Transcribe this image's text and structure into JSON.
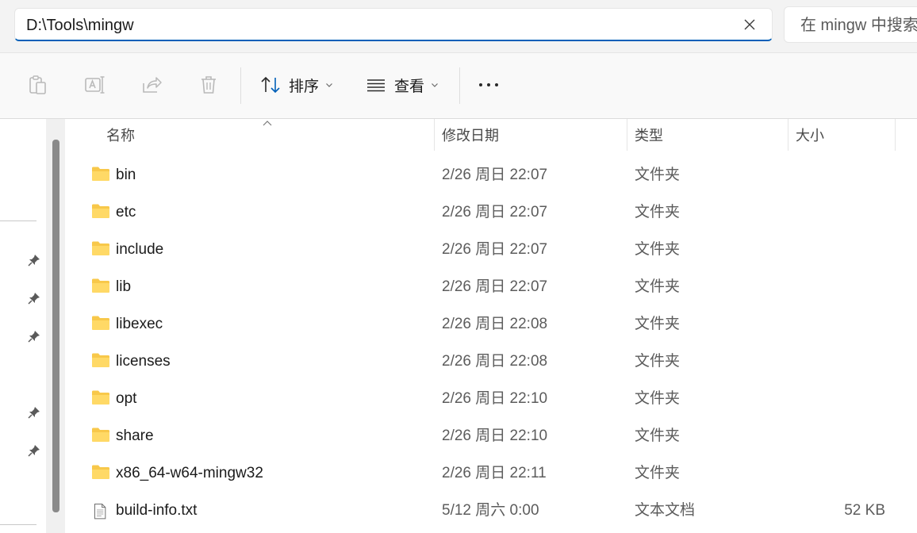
{
  "address": {
    "path": "D:\\Tools\\mingw"
  },
  "search": {
    "placeholder": "在 mingw 中搜索"
  },
  "toolbar": {
    "sort_label": "排序",
    "view_label": "查看"
  },
  "columns": {
    "name": "名称",
    "date": "修改日期",
    "type": "类型",
    "size": "大小"
  },
  "files": [
    {
      "name": "bin",
      "date": "2/26 周日 22:07",
      "type": "文件夹",
      "size": "",
      "kind": "folder"
    },
    {
      "name": "etc",
      "date": "2/26 周日 22:07",
      "type": "文件夹",
      "size": "",
      "kind": "folder"
    },
    {
      "name": "include",
      "date": "2/26 周日 22:07",
      "type": "文件夹",
      "size": "",
      "kind": "folder"
    },
    {
      "name": "lib",
      "date": "2/26 周日 22:07",
      "type": "文件夹",
      "size": "",
      "kind": "folder"
    },
    {
      "name": "libexec",
      "date": "2/26 周日 22:08",
      "type": "文件夹",
      "size": "",
      "kind": "folder"
    },
    {
      "name": "licenses",
      "date": "2/26 周日 22:08",
      "type": "文件夹",
      "size": "",
      "kind": "folder"
    },
    {
      "name": "opt",
      "date": "2/26 周日 22:10",
      "type": "文件夹",
      "size": "",
      "kind": "folder"
    },
    {
      "name": "share",
      "date": "2/26 周日 22:10",
      "type": "文件夹",
      "size": "",
      "kind": "folder"
    },
    {
      "name": "x86_64-w64-mingw32",
      "date": "2/26 周日 22:11",
      "type": "文件夹",
      "size": "",
      "kind": "folder"
    },
    {
      "name": "build-info.txt",
      "date": "5/12 周六 0:00",
      "type": "文本文档",
      "size": "52 KB",
      "kind": "text-file"
    }
  ],
  "colors": {
    "accent": "#005fb8",
    "folder": "#f8c84a"
  }
}
